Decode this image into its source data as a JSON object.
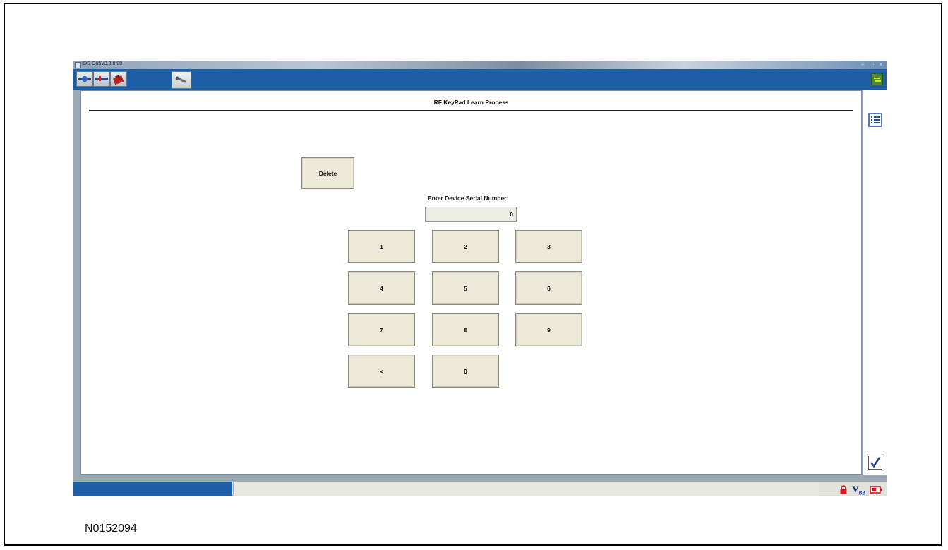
{
  "window": {
    "title": "IDS-G85V3.3.0.00"
  },
  "page": {
    "title": "RF KeyPad Learn Process"
  },
  "delete_button": {
    "label": "Delete"
  },
  "serial": {
    "label": "Enter Device Serial Number:",
    "value": "0"
  },
  "keypad": {
    "keys": [
      "1",
      "2",
      "3",
      "4",
      "5",
      "6",
      "7",
      "8",
      "9",
      "<",
      "0"
    ]
  },
  "status": {
    "voltage_icon_text": "V",
    "voltage_icon_sub": "BB"
  },
  "figure": {
    "id": "N0152094"
  },
  "icons": {
    "toolbar": [
      "vehicle-connect-icon",
      "network-icon",
      "toolbox-icon",
      "wrench-icon"
    ],
    "side": [
      "list-icon",
      "checkmark-icon"
    ],
    "status": [
      "lock-icon",
      "voltage-icon",
      "battery-icon"
    ]
  },
  "colors": {
    "toolbar_blue": "#1c5fa6",
    "button_face": "#ece9d8"
  }
}
